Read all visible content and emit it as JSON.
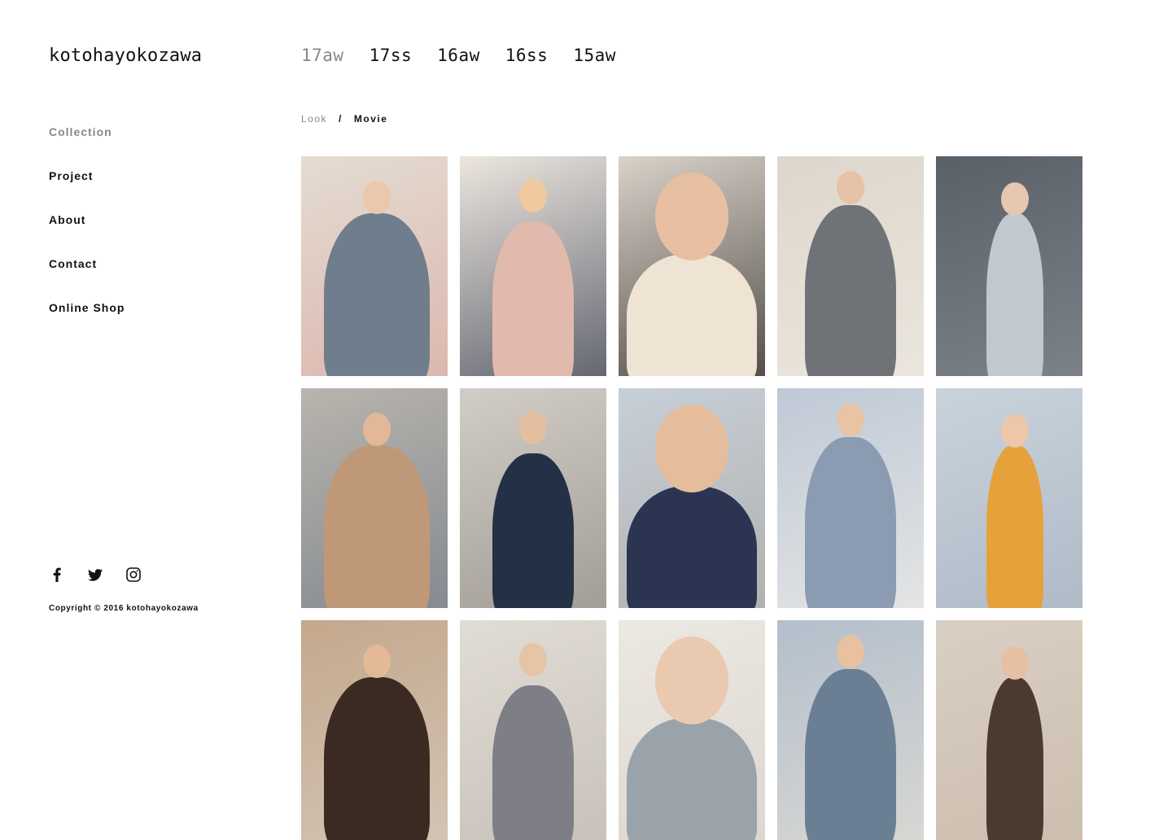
{
  "brand": {
    "logo_text": "kotohayokozawa"
  },
  "seasons": [
    {
      "label": "17aw",
      "active": true
    },
    {
      "label": "17ss",
      "active": false
    },
    {
      "label": "16aw",
      "active": false
    },
    {
      "label": "16ss",
      "active": false
    },
    {
      "label": "15aw",
      "active": false
    }
  ],
  "sidebar": {
    "items": [
      {
        "label": "Collection",
        "active": true
      },
      {
        "label": "Project",
        "active": false
      },
      {
        "label": "About",
        "active": false
      },
      {
        "label": "Contact",
        "active": false
      },
      {
        "label": "Online Shop",
        "active": false
      }
    ]
  },
  "subnav": {
    "look": "Look",
    "separator": "/",
    "movie": "Movie"
  },
  "gallery": {
    "tiles": [
      {
        "name": "look-1",
        "bg": "#e4dcd2",
        "fig": "#6f7d8c",
        "skin": "#e9c8ad",
        "accent": "#d9a8a0"
      },
      {
        "name": "look-2",
        "bg": "#ece6de",
        "fig": "#e2b9ad",
        "skin": "#f0c9a0",
        "accent": "#2e3448"
      },
      {
        "name": "look-3",
        "bg": "#d9d2c9",
        "fig": "#efe3d4",
        "skin": "#e8bfa1",
        "accent": "#1f1a18"
      },
      {
        "name": "look-4",
        "bg": "#ddd6cc",
        "fig": "#6f7378",
        "skin": "#e6c3a8",
        "accent": "#f0ece4"
      },
      {
        "name": "look-5",
        "bg": "#5a6068",
        "fig": "#c2c8d0",
        "skin": "#e8c7b0",
        "accent": "#8a8f96"
      },
      {
        "name": "look-6",
        "bg": "#b9b4ad",
        "fig": "#bf9977",
        "skin": "#e2b898",
        "accent": "#6f7a86"
      },
      {
        "name": "look-7",
        "bg": "#d2cdc6",
        "fig": "#243045",
        "skin": "#e4bf9f",
        "accent": "#8f8a82"
      },
      {
        "name": "look-8",
        "bg": "#c7cfd8",
        "fig": "#2b3552",
        "skin": "#e6bd9c",
        "accent": "#a8a6a0"
      },
      {
        "name": "look-9",
        "bg": "#bfc9d6",
        "fig": "#8a9bb2",
        "skin": "#e8c3a4",
        "accent": "#f2efea"
      },
      {
        "name": "look-10",
        "bg": "#c9d3dc",
        "fig": "#e6a23a",
        "skin": "#edc7a8",
        "accent": "#a6b1c0"
      },
      {
        "name": "look-11",
        "bg": "#c4a88c",
        "fig": "#3a2a22",
        "skin": "#e3b996",
        "accent": "#d8cfc4"
      },
      {
        "name": "look-12",
        "bg": "#e1dcd5",
        "fig": "#7d7e86",
        "skin": "#e6c4a6",
        "accent": "#bdb7ae"
      },
      {
        "name": "look-13",
        "bg": "#ece8e2",
        "fig": "#9aa2aa",
        "skin": "#e9c9af",
        "accent": "#d6d0c8"
      },
      {
        "name": "look-14",
        "bg": "#b3bfcc",
        "fig": "#6b7f94",
        "skin": "#e7c1a0",
        "accent": "#e6e0d6"
      },
      {
        "name": "look-15",
        "bg": "#d9cfc4",
        "fig": "#4a3a30",
        "skin": "#e6c0a2",
        "accent": "#c8b8a6"
      }
    ]
  },
  "social": [
    {
      "name": "facebook-icon"
    },
    {
      "name": "twitter-icon"
    },
    {
      "name": "instagram-icon"
    }
  ],
  "footer": {
    "copyright": "Copyright © 2016 kotohayokozawa"
  }
}
